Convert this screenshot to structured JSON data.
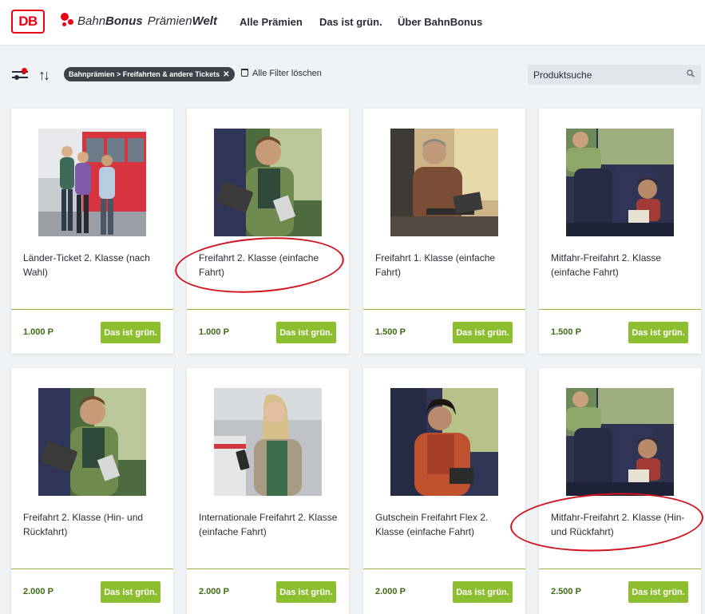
{
  "header": {
    "logo_text": "DB",
    "brand": {
      "part1": "Bahn",
      "part2": "Bonus",
      "part3": "Prämien",
      "part4": "Welt"
    },
    "nav": [
      "Alle Prämien",
      "Das ist grün.",
      "Über BahnBonus"
    ]
  },
  "filters": {
    "active_chip": "Bahnprämien > Freifahrten & andere Tickets",
    "clear_label": "Alle Filter löschen",
    "search_placeholder": "Produktsuche"
  },
  "colors": {
    "brand_red": "#ec0016",
    "green_button": "#8cbe30",
    "price_green": "#3d6b12",
    "highlight_ellipse": "#d0131d"
  },
  "products": [
    {
      "title": "Länder-Ticket 2. Klasse (nach Wahl)",
      "price": "1.000 P",
      "badge": "Das ist grün.",
      "image": "group-on-platform"
    },
    {
      "title": "Freifahrt 2. Klasse (einfache Fahrt)",
      "price": "1.000 P",
      "badge": "Das ist grün.",
      "image": "man-with-tablet-in-train",
      "highlighted": true
    },
    {
      "title": "Freifahrt 1. Klasse (einfache Fahrt)",
      "price": "1.500 P",
      "badge": "Das ist grün.",
      "image": "man-with-laptop-in-train"
    },
    {
      "title": "Mitfahr-Freifahrt 2. Klasse (einfache Fahrt)",
      "price": "1.500 P",
      "badge": "Das ist grün.",
      "image": "family-in-train"
    },
    {
      "title": "Freifahrt 2. Klasse (Hin- und Rückfahrt)",
      "price": "2.000 P",
      "badge": "Das ist grün.",
      "image": "man-with-tablet-in-train"
    },
    {
      "title": "Internationale Freifahrt 2. Klasse (einfache Fahrt)",
      "price": "2.000 P",
      "badge": "Das ist grün.",
      "image": "woman-with-phone-at-station"
    },
    {
      "title": "Gutschein Freifahrt Flex 2. Klasse (einfache Fahrt)",
      "price": "2.000 P",
      "badge": "Das ist grün.",
      "image": "woman-smiling-in-train"
    },
    {
      "title": "Mitfahr-Freifahrt 2. Klasse (Hin- und Rückfahrt)",
      "price": "2.500 P",
      "badge": "Das ist grün.",
      "image": "family-in-train",
      "highlighted": true
    }
  ]
}
